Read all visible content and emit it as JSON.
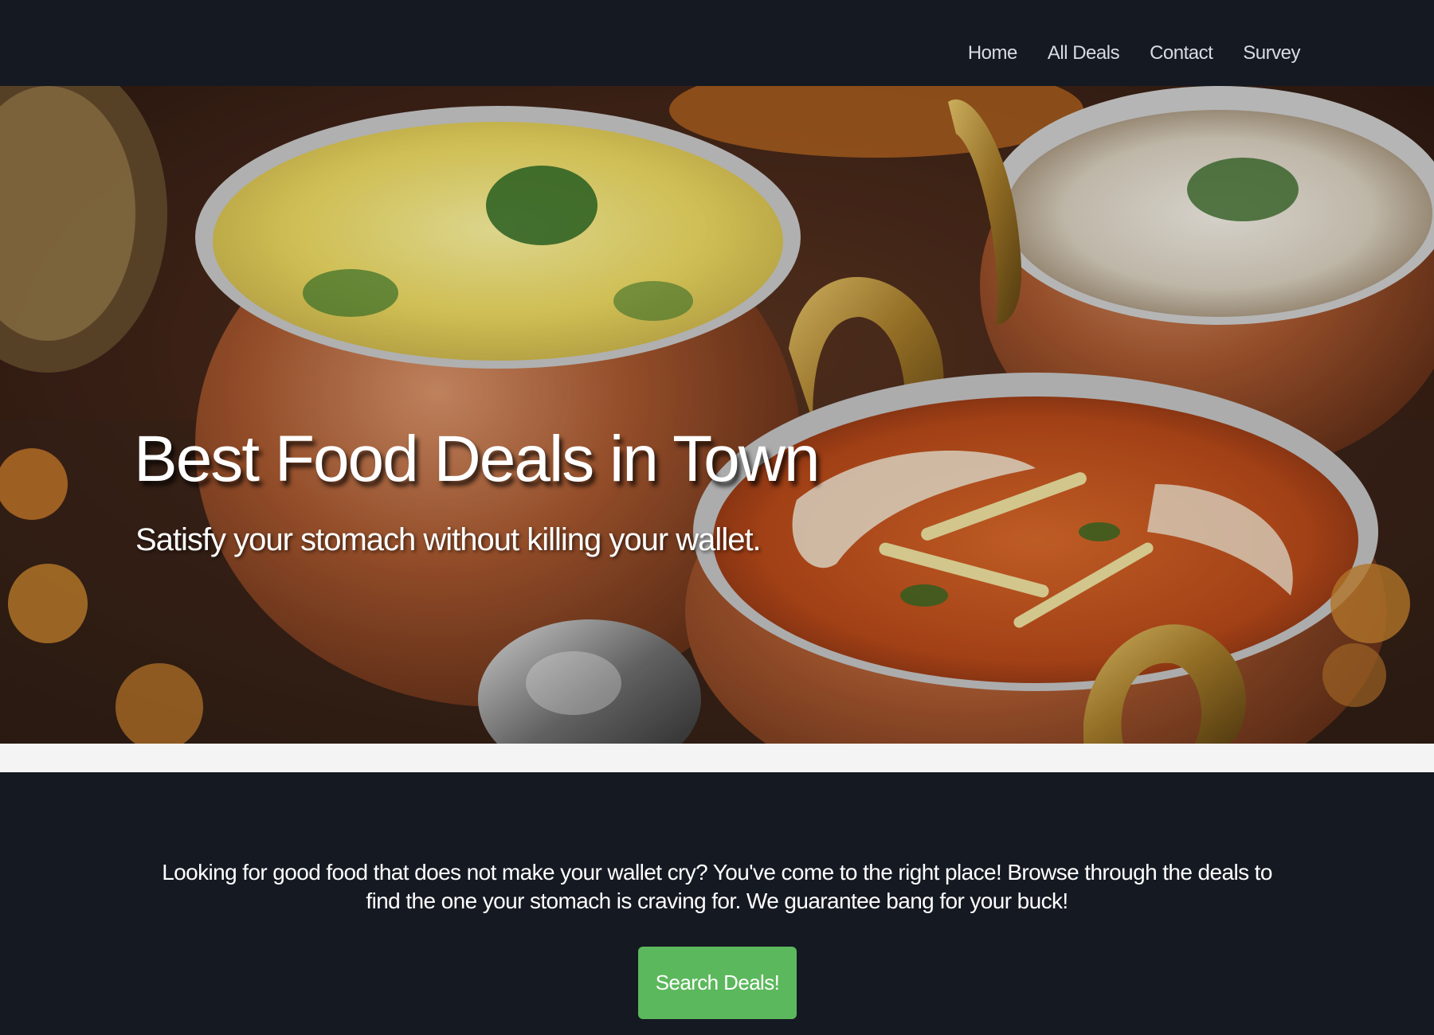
{
  "nav": {
    "items": [
      {
        "label": "Home"
      },
      {
        "label": "All Deals"
      },
      {
        "label": "Contact"
      },
      {
        "label": "Survey"
      }
    ]
  },
  "hero": {
    "title": "Best Food Deals in Town",
    "subtitle": "Satisfy your stomach without killing your wallet.",
    "image_subject": "bowls-of-indian-food-photo"
  },
  "intro": {
    "text": "Looking for good food that does not make your wallet cry? You've come to the right place! Browse through the deals to find the one your stomach is craving for. We guarantee bang for your buck!",
    "button_label": "Search Deals!"
  },
  "colors": {
    "background": "#151922",
    "band": "#f4f4f4",
    "button": "#5cb85c",
    "text": "#ffffff",
    "nav_text": "#d8dbe0"
  }
}
